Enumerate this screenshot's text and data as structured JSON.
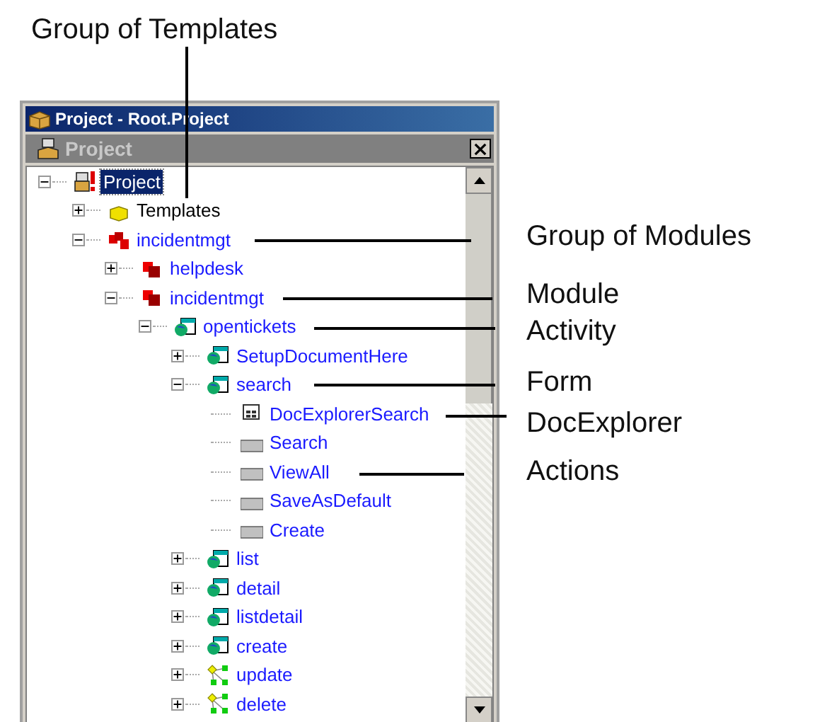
{
  "annotations": [
    {
      "text": "Group of Templates"
    },
    {
      "text": "Group of Modules"
    },
    {
      "text": "Module"
    },
    {
      "text": "Activity"
    },
    {
      "text": "Form"
    },
    {
      "text": "DocExplorer"
    },
    {
      "text": "Actions"
    }
  ],
  "window": {
    "title": "Project - Root.Project",
    "panel_title": "Project"
  },
  "tree": [
    {
      "label": "Project",
      "kind": "project",
      "expanded": true,
      "selected": true,
      "children": [
        {
          "label": "Templates",
          "kind": "templates",
          "expanded": false,
          "selected": false
        },
        {
          "label": "incidentmgt",
          "kind": "module-group",
          "expanded": true,
          "selected": false,
          "children": [
            {
              "label": "helpdesk",
              "kind": "module",
              "expanded": false,
              "selected": false
            },
            {
              "label": "incidentmgt",
              "kind": "module",
              "expanded": true,
              "selected": false,
              "children": [
                {
                  "label": "opentickets",
                  "kind": "activity",
                  "expanded": true,
                  "selected": false,
                  "children": [
                    {
                      "label": "SetupDocumentHere",
                      "kind": "form",
                      "expanded": false,
                      "selected": false
                    },
                    {
                      "label": "search",
                      "kind": "form",
                      "expanded": true,
                      "selected": false,
                      "children": [
                        {
                          "label": "DocExplorerSearch",
                          "kind": "docexplorer",
                          "selected": false
                        },
                        {
                          "label": "Search",
                          "kind": "action",
                          "selected": false
                        },
                        {
                          "label": "ViewAll",
                          "kind": "action",
                          "selected": false
                        },
                        {
                          "label": "SaveAsDefault",
                          "kind": "action",
                          "selected": false
                        },
                        {
                          "label": "Create",
                          "kind": "action",
                          "selected": false
                        }
                      ]
                    },
                    {
                      "label": "list",
                      "kind": "form",
                      "expanded": false,
                      "selected": false
                    },
                    {
                      "label": "detail",
                      "kind": "form",
                      "expanded": false,
                      "selected": false
                    },
                    {
                      "label": "listdetail",
                      "kind": "form",
                      "expanded": false,
                      "selected": false
                    },
                    {
                      "label": "create",
                      "kind": "form",
                      "expanded": false,
                      "selected": false
                    },
                    {
                      "label": "update",
                      "kind": "workflow",
                      "expanded": false,
                      "selected": false
                    },
                    {
                      "label": "delete",
                      "kind": "workflow",
                      "expanded": false,
                      "selected": false
                    }
                  ]
                }
              ]
            }
          ]
        }
      ]
    }
  ]
}
